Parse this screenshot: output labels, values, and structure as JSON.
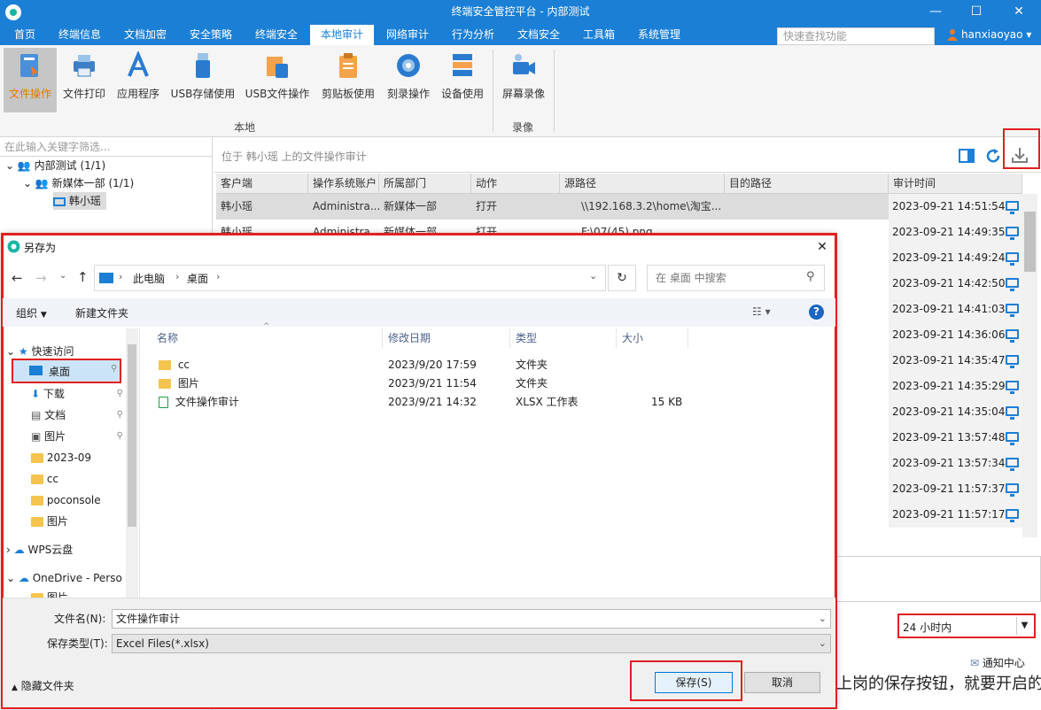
{
  "app": {
    "title": "终端安全管控平台 - 内部测试",
    "minimize": "—",
    "maximize": "☐",
    "close": "✕"
  },
  "menu": {
    "tabs": [
      "首页",
      "终端信息",
      "文档加密",
      "安全策略",
      "终端安全",
      "本地审计",
      "网络审计",
      "行为分析",
      "文档安全",
      "工具箱",
      "系统管理"
    ],
    "active_index": 5,
    "search_placeholder": "快速查找功能",
    "user_name": "hanxiaoyao",
    "user_caret": "▾"
  },
  "ribbon": {
    "local_buttons": [
      "文件操作",
      "文件打印",
      "应用程序",
      "USB存储使用",
      "USB文件操作",
      "剪贴板使用",
      "刻录操作",
      "设备使用"
    ],
    "active_button": "文件操作",
    "local_group": "本地",
    "record_buttons": [
      "屏幕录像"
    ],
    "record_group": "录像"
  },
  "tree": {
    "filter_placeholder": "在此输入关键字筛选...",
    "root": "内部测试 (1/1)",
    "dept": "新媒体一部 (1/1)",
    "user": "韩小瑶"
  },
  "main": {
    "title": "位于 韩小瑶 上的文件操作审计",
    "columns": [
      "客户端",
      "操作系统账户",
      "所属部门",
      "动作",
      "源路径",
      "目的路径",
      "审计时间"
    ],
    "rows": [
      {
        "client": "韩小瑶",
        "account": "Administra...",
        "dept": "新媒体一部",
        "action": "打开",
        "src": "\\\\192.168.3.2\\home\\淘宝...",
        "time": "2023-09-21 14:51:54"
      },
      {
        "client": "韩小瑶",
        "account": "Administra...",
        "dept": "新媒体一部",
        "action": "打开",
        "src": "F:\\07(45).png",
        "time": "2023-09-21 14:49:35"
      }
    ],
    "more_times": [
      "2023-09-21 14:49:24",
      "2023-09-21 14:42:50",
      "2023-09-21 14:41:03",
      "2023-09-21 14:36:06",
      "2023-09-21 14:35:47",
      "2023-09-21 14:35:29",
      "2023-09-21 14:35:04",
      "2023-09-21 13:57:48",
      "2023-09-21 13:57:34",
      "2023-09-21 11:57:37",
      "2023-09-21 11:57:17"
    ],
    "time_range": "24 小时内",
    "notification": "通知中心",
    "partial_text": "上岗的保存按钮，就要开启的"
  },
  "dialog": {
    "title": "另存为",
    "close": "✕",
    "path": [
      "此电脑",
      "桌面"
    ],
    "search_placeholder": "在 桌面 中搜索",
    "organize": "组织",
    "new_folder": "新建文件夹",
    "nav": {
      "quick_access": "快速访问",
      "items": [
        "桌面",
        "下载",
        "文档",
        "图片",
        "2023-09",
        "cc",
        "poconsole",
        "图片"
      ],
      "wps": "WPS云盘",
      "onedrive": "OneDrive - Perso",
      "partial": "图片"
    },
    "columns": [
      "名称",
      "修改日期",
      "类型",
      "大小"
    ],
    "files": [
      {
        "name": "cc",
        "date": "2023/9/20 17:59",
        "type": "文件夹",
        "size": ""
      },
      {
        "name": "图片",
        "date": "2023/9/21 11:54",
        "type": "文件夹",
        "size": ""
      },
      {
        "name": "文件操作审计",
        "date": "2023/9/21 14:32",
        "type": "XLSX 工作表",
        "size": "15 KB"
      }
    ],
    "filename_label": "文件名(N):",
    "filename_value": "文件操作审计",
    "filetype_label": "保存类型(T):",
    "filetype_value": "Excel Files(*.xlsx)",
    "hide_folders": "隐藏文件夹",
    "save": "保存(S)",
    "cancel": "取消"
  },
  "colors": {
    "brand": "#1b7fd6",
    "highlight": "#e02020",
    "active_orange": "#e07b00"
  }
}
